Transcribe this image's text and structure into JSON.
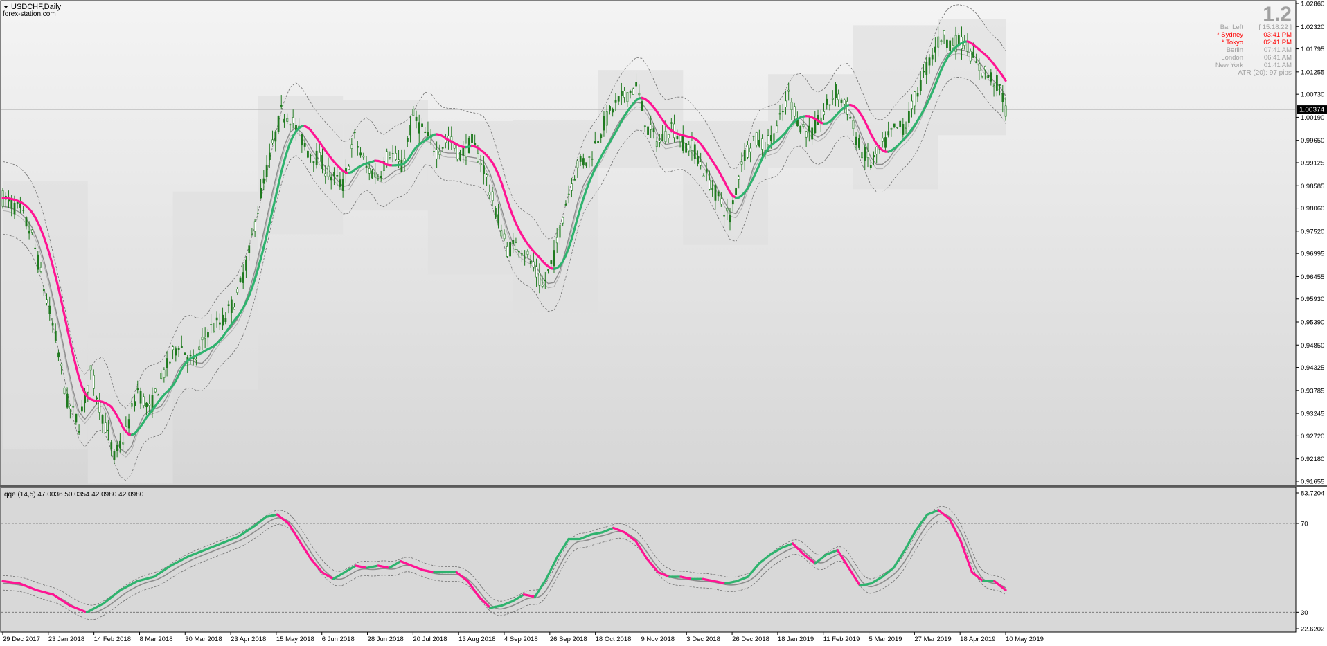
{
  "window": {
    "symbol_label": "USDCHF,Daily",
    "watermark": "forex-station.com"
  },
  "info_panel": {
    "big_number": "1.2",
    "rows": [
      {
        "label": "Bar Left",
        "value": "[ 15:18:22 ]",
        "color": "#a0a0a0"
      },
      {
        "label": "* Sydney",
        "value": "03:41 PM",
        "color": "#ff0000"
      },
      {
        "label": "* Tokyo",
        "value": "02:41 PM",
        "color": "#ff0000"
      },
      {
        "label": "Berlin",
        "value": "07:41 AM",
        "color": "#a0a0a0"
      },
      {
        "label": "London",
        "value": "06:41 AM",
        "color": "#a0a0a0"
      },
      {
        "label": "New York",
        "value": "01:41 AM",
        "color": "#a0a0a0"
      }
    ],
    "atr_text": "ATR (20): 97 pips"
  },
  "colors": {
    "bull": "#2fb36e",
    "bear": "#ff1493",
    "candle": "#1f7a1f",
    "grey_line": "#8c8c8c",
    "band": "#6e6e6e",
    "price_tag_bg": "#000000"
  },
  "chart_data": [
    {
      "type": "line",
      "name": "price",
      "symbol": "USDCHF",
      "timeframe": "Daily",
      "y_ticks": [
        "1.02860",
        "1.02320",
        "1.01795",
        "1.01255",
        "1.00730",
        "1.00190",
        "0.99650",
        "0.99125",
        "0.98585",
        "0.98060",
        "0.97520",
        "0.96995",
        "0.96455",
        "0.95930",
        "0.95390",
        "0.94850",
        "0.94325",
        "0.93785",
        "0.93245",
        "0.92720",
        "0.92180",
        "0.91655"
      ],
      "ylim": [
        0.91655,
        1.0286
      ],
      "current_price": 1.00374,
      "current_price_label": "1.00374",
      "x_labels": [
        "29 Dec 2017",
        "23 Jan 2018",
        "14 Feb 2018",
        "8 Mar 2018",
        "30 Mar 2018",
        "23 Apr 2018",
        "15 May 2018",
        "6 Jun 2018",
        "28 Jun 2018",
        "20 Jul 2018",
        "13 Aug 2018",
        "4 Sep 2018",
        "26 Sep 2018",
        "18 Oct 2018",
        "9 Nov 2018",
        "3 Dec 2018",
        "26 Dec 2018",
        "18 Jan 2019",
        "11 Feb 2019",
        "5 Mar 2019",
        "27 Mar 2019",
        "18 Apr 2019",
        "10 May 2019"
      ],
      "price_path": [
        [
          0,
          0.983
        ],
        [
          6,
          0.98
        ],
        [
          10,
          0.974
        ],
        [
          14,
          0.962
        ],
        [
          18,
          0.95
        ],
        [
          22,
          0.935
        ],
        [
          26,
          0.93
        ],
        [
          30,
          0.942
        ],
        [
          34,
          0.932
        ],
        [
          38,
          0.922
        ],
        [
          42,
          0.928
        ],
        [
          46,
          0.938
        ],
        [
          50,
          0.933
        ],
        [
          55,
          0.942
        ],
        [
          60,
          0.949
        ],
        [
          65,
          0.944
        ],
        [
          70,
          0.952
        ],
        [
          75,
          0.954
        ],
        [
          80,
          0.96
        ],
        [
          84,
          0.97
        ],
        [
          88,
          0.984
        ],
        [
          92,
          0.995
        ],
        [
          95,
          1.003
        ],
        [
          98,
          1.002
        ],
        [
          101,
          0.998
        ],
        [
          104,
          0.994
        ],
        [
          108,
          0.992
        ],
        [
          112,
          0.988
        ],
        [
          116,
          0.986
        ],
        [
          120,
          0.997
        ],
        [
          124,
          0.99
        ],
        [
          128,
          0.988
        ],
        [
          132,
          0.994
        ],
        [
          136,
          0.99
        ],
        [
          140,
          1.002
        ],
        [
          144,
          0.998
        ],
        [
          148,
          0.994
        ],
        [
          152,
          0.997
        ],
        [
          156,
          0.993
        ],
        [
          160,
          0.996
        ],
        [
          164,
          0.99
        ],
        [
          168,
          0.98
        ],
        [
          172,
          0.971
        ],
        [
          176,
          0.972
        ],
        [
          180,
          0.968
        ],
        [
          184,
          0.962
        ],
        [
          188,
          0.969
        ],
        [
          192,
          0.982
        ],
        [
          196,
          0.991
        ],
        [
          200,
          0.992
        ],
        [
          204,
          0.999
        ],
        [
          208,
          1.004
        ],
        [
          212,
          1.007
        ],
        [
          216,
          1.009
        ],
        [
          220,
          0.999
        ],
        [
          224,
          0.996
        ],
        [
          228,
          1.0
        ],
        [
          232,
          0.996
        ],
        [
          236,
          0.994
        ],
        [
          240,
          0.988
        ],
        [
          244,
          0.983
        ],
        [
          248,
          0.978
        ],
        [
          252,
          0.992
        ],
        [
          256,
          0.997
        ],
        [
          260,
          0.995
        ],
        [
          264,
          0.999
        ],
        [
          268,
          1.007
        ],
        [
          272,
          1.0
        ],
        [
          276,
          0.998
        ],
        [
          280,
          1.003
        ],
        [
          284,
          1.008
        ],
        [
          288,
          1.004
        ],
        [
          292,
          0.995
        ],
        [
          296,
          0.991
        ],
        [
          300,
          0.995
        ],
        [
          304,
          0.999
        ],
        [
          308,
          1.0
        ],
        [
          312,
          1.008
        ],
        [
          316,
          1.015
        ],
        [
          320,
          1.021
        ],
        [
          324,
          1.019
        ],
        [
          328,
          1.02
        ],
        [
          332,
          1.014
        ],
        [
          336,
          1.012
        ],
        [
          340,
          1.009
        ],
        [
          342,
          1.0037
        ]
      ],
      "qqe_path": [
        [
          0,
          44
        ],
        [
          6,
          43
        ],
        [
          12,
          40
        ],
        [
          18,
          38
        ],
        [
          24,
          33
        ],
        [
          30,
          30
        ],
        [
          36,
          34
        ],
        [
          42,
          40
        ],
        [
          48,
          44
        ],
        [
          54,
          46
        ],
        [
          60,
          51
        ],
        [
          66,
          55
        ],
        [
          72,
          58
        ],
        [
          78,
          61
        ],
        [
          84,
          64
        ],
        [
          90,
          69
        ],
        [
          94,
          73
        ],
        [
          98,
          74
        ],
        [
          102,
          70
        ],
        [
          106,
          62
        ],
        [
          110,
          54
        ],
        [
          114,
          48
        ],
        [
          118,
          45
        ],
        [
          122,
          48
        ],
        [
          126,
          51
        ],
        [
          130,
          50
        ],
        [
          134,
          51
        ],
        [
          138,
          50
        ],
        [
          142,
          53
        ],
        [
          146,
          51
        ],
        [
          150,
          49
        ],
        [
          154,
          48
        ],
        [
          158,
          48
        ],
        [
          162,
          48
        ],
        [
          166,
          44
        ],
        [
          170,
          37
        ],
        [
          174,
          32
        ],
        [
          178,
          33
        ],
        [
          182,
          35
        ],
        [
          186,
          38
        ],
        [
          190,
          37
        ],
        [
          194,
          45
        ],
        [
          198,
          55
        ],
        [
          202,
          63
        ],
        [
          206,
          63
        ],
        [
          210,
          65
        ],
        [
          214,
          66
        ],
        [
          218,
          68
        ],
        [
          222,
          66
        ],
        [
          226,
          62
        ],
        [
          230,
          54
        ],
        [
          234,
          48
        ],
        [
          238,
          46
        ],
        [
          242,
          46
        ],
        [
          246,
          45
        ],
        [
          250,
          45
        ],
        [
          254,
          44
        ],
        [
          258,
          43
        ],
        [
          262,
          44
        ],
        [
          266,
          46
        ],
        [
          270,
          52
        ],
        [
          274,
          56
        ],
        [
          278,
          59
        ],
        [
          282,
          61
        ],
        [
          286,
          56
        ],
        [
          290,
          52
        ],
        [
          294,
          56
        ],
        [
          298,
          58
        ],
        [
          302,
          50
        ],
        [
          306,
          42
        ],
        [
          310,
          43
        ],
        [
          314,
          46
        ],
        [
          318,
          50
        ],
        [
          322,
          58
        ],
        [
          326,
          67
        ],
        [
          330,
          74
        ],
        [
          334,
          76
        ],
        [
          338,
          72
        ],
        [
          342,
          62
        ],
        [
          346,
          48
        ],
        [
          350,
          44
        ],
        [
          354,
          44
        ],
        [
          358,
          40
        ]
      ]
    },
    {
      "type": "line",
      "name": "qqe",
      "indicator_label": "qqe (14,5) 47.0036 50.0354 42.0980 42.0980",
      "y_ticks": [
        "83.7204",
        "70",
        "30",
        "22.6202"
      ],
      "ylim": [
        22.6202,
        83.7204
      ],
      "levels": [
        30,
        70
      ]
    }
  ]
}
